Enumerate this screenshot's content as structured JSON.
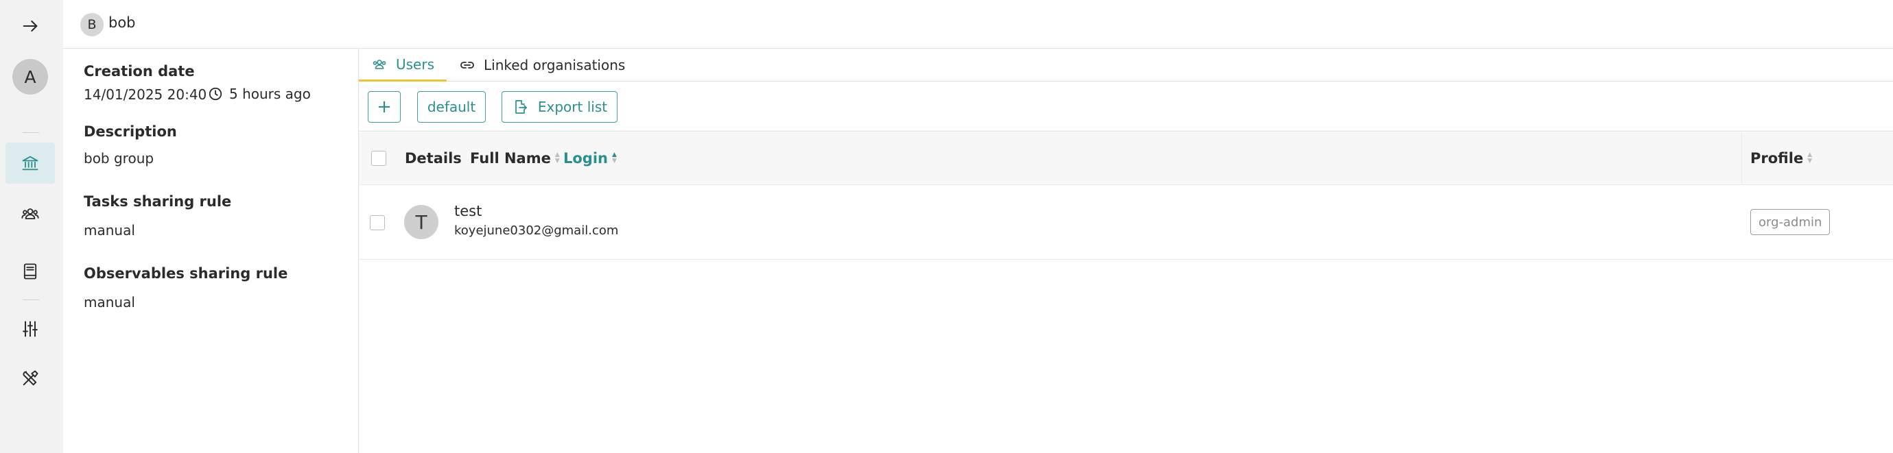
{
  "rail": {
    "avatar_initial": "A",
    "items": [
      {
        "icon": "arrow-right-icon"
      },
      {
        "icon": "bank-icon",
        "active": true
      },
      {
        "icon": "users-icon"
      },
      {
        "icon": "book-icon"
      },
      {
        "icon": "sliders-icon"
      },
      {
        "icon": "tools-icon"
      }
    ],
    "active_color": "#2a8f8f"
  },
  "header": {
    "initial": "B",
    "name": "bob"
  },
  "details": {
    "creation_label": "Creation date",
    "creation_value": "14/01/2025 20:40",
    "creation_ago": "5 hours ago",
    "description_label": "Description",
    "description_value": "bob group",
    "tasks_label": "Tasks sharing rule",
    "tasks_value": "manual",
    "observables_label": "Observables sharing rule",
    "observables_value": "manual"
  },
  "tabs": [
    {
      "label": "Users",
      "active": true,
      "icon": "users-icon"
    },
    {
      "label": "Linked organisations",
      "active": false,
      "icon": "link-icon"
    }
  ],
  "toolbar": {
    "add_label": "+",
    "default_label": "default",
    "export_label": "Export list"
  },
  "table": {
    "columns": {
      "details": "Details",
      "full_name": "Full Name",
      "login": "Login",
      "profile": "Profile"
    },
    "rows": [
      {
        "initial": "T",
        "name": "test",
        "email": "koyejune0302@gmail.com",
        "profile": "org-admin"
      }
    ]
  },
  "colors": {
    "accent": "#2a8f8f",
    "tab_underline": "#f1c232",
    "rail_bg": "#f2f2f2"
  }
}
